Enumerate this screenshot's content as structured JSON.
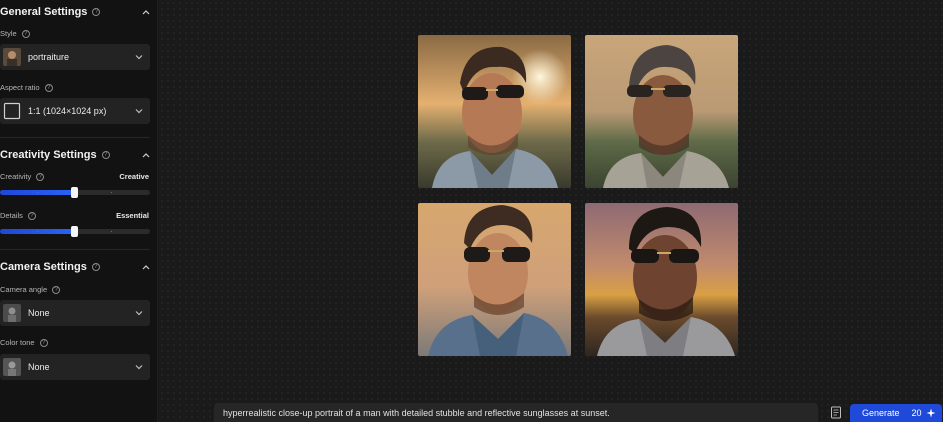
{
  "sidebar": {
    "general": {
      "title": "General Settings",
      "style_label": "Style",
      "style_value": "portraiture",
      "aspect_label": "Aspect ratio",
      "aspect_value": "1:1 (1024×1024 px)"
    },
    "creativity": {
      "title": "Creativity Settings",
      "creativity_label": "Creativity",
      "creativity_value": "Creative",
      "creativity_level": 0.5,
      "details_label": "Details",
      "details_value": "Essential",
      "details_level": 0.5
    },
    "camera": {
      "title": "Camera Settings",
      "angle_label": "Camera angle",
      "angle_value": "None",
      "tone_label": "Color tone",
      "tone_value": "None"
    }
  },
  "prompt": {
    "text": "hyperrealistic close-up portrait of a man with detailed stubble and reflective sunglasses at sunset."
  },
  "generate": {
    "label": "Generate",
    "credits": "20"
  },
  "colors": {
    "accent": "#1f49d8",
    "background": "#171717",
    "sidebar": "#121212"
  }
}
